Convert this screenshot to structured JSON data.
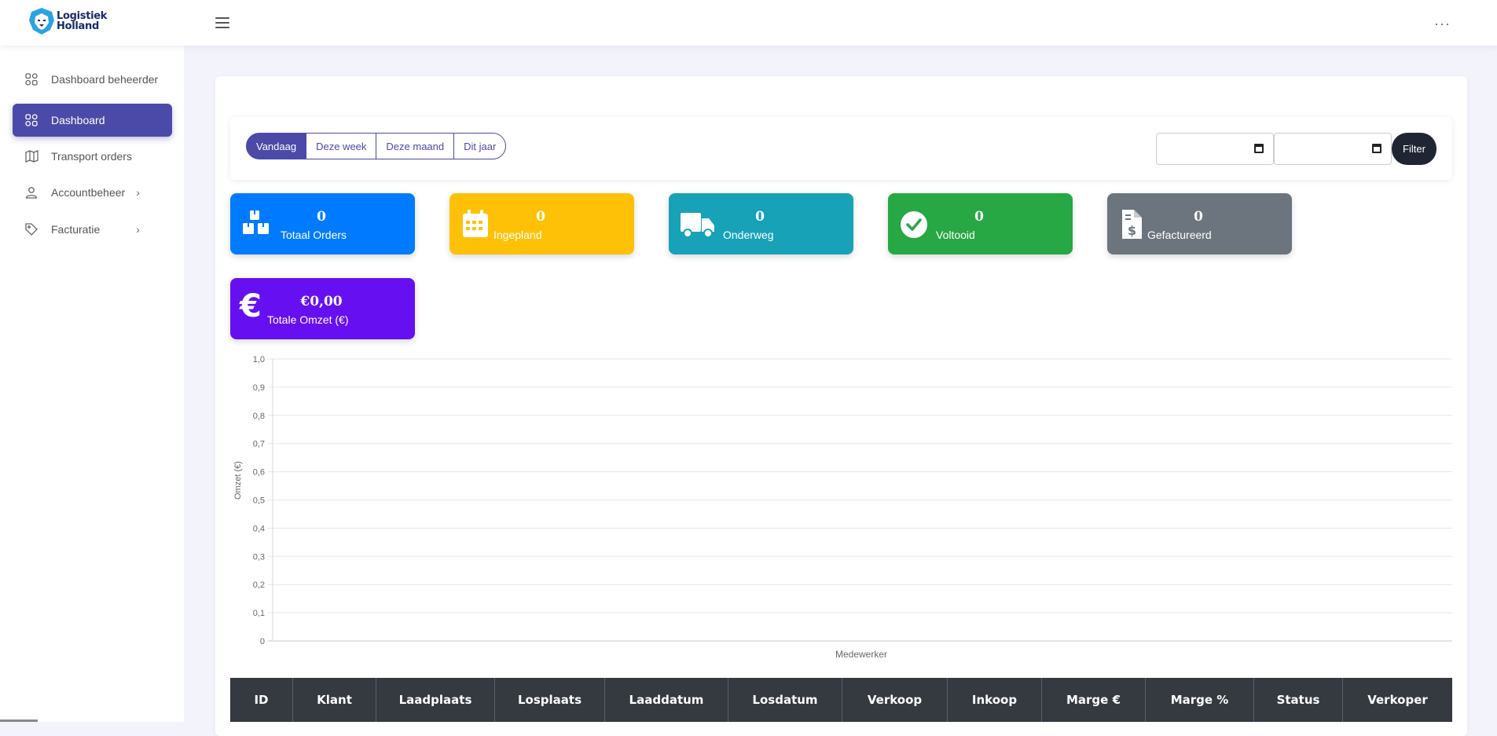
{
  "app": {
    "logo_line1": "Logistiek",
    "logo_line2": "Holland"
  },
  "topbar": {
    "menu_icon": "hamburger-icon",
    "more_icon": "more-dots-icon"
  },
  "sidebar": {
    "items": [
      {
        "label": "Dashboard beheerder",
        "icon": "grid-icon",
        "active": false,
        "has_children": false
      },
      {
        "label": "Dashboard",
        "icon": "grid-icon",
        "active": true,
        "has_children": false
      },
      {
        "label": "Transport orders",
        "icon": "map-icon",
        "active": false,
        "has_children": false
      },
      {
        "label": "Accountbeheer",
        "icon": "user-icon",
        "active": false,
        "has_children": true
      },
      {
        "label": "Facturatie",
        "icon": "tag-icon",
        "active": false,
        "has_children": true
      }
    ]
  },
  "filters": {
    "periods": [
      "Vandaag",
      "Deze week",
      "Deze maand",
      "Dit jaar"
    ],
    "active_period": "Vandaag",
    "date_from": "",
    "date_to": "",
    "filter_label": "Filter"
  },
  "stats": [
    {
      "value": "0",
      "label": "Totaal Orders",
      "icon": "boxes-icon",
      "color": "#007bff"
    },
    {
      "value": "0",
      "label": "Ingepland",
      "icon": "calendar-icon",
      "color": "#ffc107"
    },
    {
      "value": "0",
      "label": "Onderweg",
      "icon": "truck-icon",
      "color": "#17a2b8"
    },
    {
      "value": "0",
      "label": "Voltooid",
      "icon": "check-circle-icon",
      "color": "#28a745"
    },
    {
      "value": "0",
      "label": "Gefactureerd",
      "icon": "invoice-icon",
      "color": "#6c757d"
    },
    {
      "value": "€0,00",
      "label": "Totale Omzet (€)",
      "icon": "euro-icon",
      "color": "#6610f2"
    }
  ],
  "chart_data": {
    "type": "bar",
    "categories": [],
    "series": [],
    "xlabel": "Medewerker",
    "ylabel": "Omzet (€)",
    "ylim": [
      0,
      1
    ],
    "yticks": [
      "0",
      "0,1",
      "0,2",
      "0,3",
      "0,4",
      "0,5",
      "0,6",
      "0,7",
      "0,8",
      "0,9",
      "1,0"
    ],
    "grid": true
  },
  "table": {
    "columns": [
      "ID",
      "Klant",
      "Laadplaats",
      "Losplaats",
      "Laaddatum",
      "Losdatum",
      "Verkoop",
      "Inkoop",
      "Marge €",
      "Marge %",
      "Status",
      "Verkoper"
    ]
  }
}
